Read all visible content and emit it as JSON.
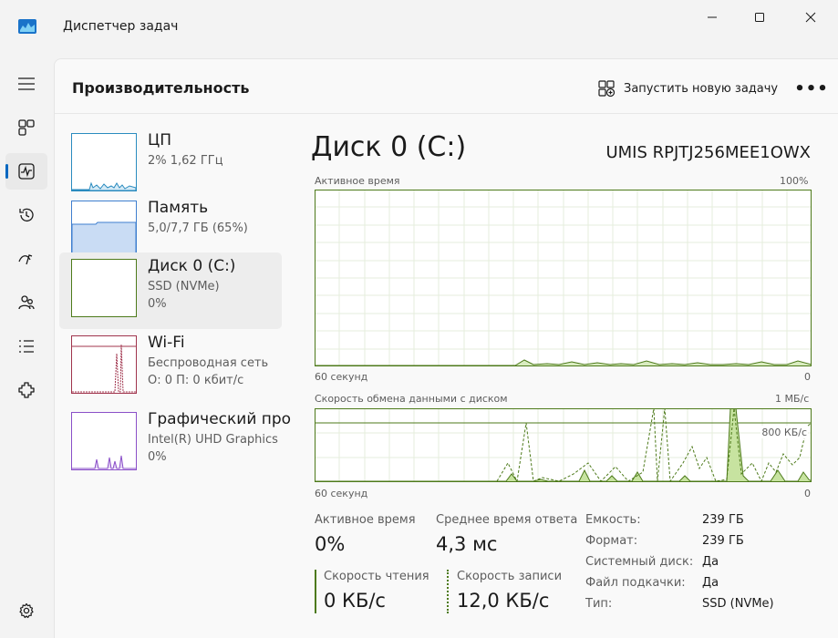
{
  "window": {
    "title": "Диспетчер задач"
  },
  "header": {
    "page_title": "Производительность",
    "run_task_label": "Запустить новую задачу",
    "more_label": "•••"
  },
  "resources": [
    {
      "name": "ЦП",
      "line1": "2%  1,62 ГГц",
      "line2": ""
    },
    {
      "name": "Память",
      "line1": "5,0/7,7 ГБ (65%)",
      "line2": ""
    },
    {
      "name": "Диск 0 (C:)",
      "line1": "SSD (NVMe)",
      "line2": "0%"
    },
    {
      "name": "Wi-Fi",
      "line1": "Беспроводная сеть",
      "line2": "О: 0  П: 0 кбит/с"
    },
    {
      "name": "Графический про",
      "line1": "Intel(R) UHD Graphics",
      "line2": "0%"
    }
  ],
  "detail": {
    "title": "Диск 0 (C:)",
    "model": "UMIS RPJTJ256MEE1OWX",
    "graph1": {
      "label": "Активное время",
      "max": "100%",
      "time_label": "60 секунд",
      "min": "0"
    },
    "graph2": {
      "label": "Скорость обмена данными с диском",
      "max": "1 МБ/с",
      "mid": "800 КБ/с",
      "time_label": "60 секунд",
      "min": "0"
    },
    "stats": {
      "active_time_label": "Активное время",
      "active_time_value": "0%",
      "response_label": "Среднее время ответа",
      "response_value": "4,3 мс",
      "read_label": "Скорость чтения",
      "read_value": "0 КБ/с",
      "write_label": "Скорость записи",
      "write_value": "12,0 КБ/с"
    },
    "properties": [
      {
        "key": "Емкость:",
        "value": "239 ГБ"
      },
      {
        "key": "Формат:",
        "value": "239 ГБ"
      },
      {
        "key": "Системный диск:",
        "value": "Да"
      },
      {
        "key": "Файл подкачки:",
        "value": "Да"
      },
      {
        "key": "Тип:",
        "value": "SSD (NVMe)"
      }
    ]
  },
  "colors": {
    "disk_line": "#4d7a1a",
    "disk_fill": "#c7e3a0",
    "cpu_line": "#2a8bbf",
    "memory_fill": "#c9dcf4",
    "memory_line": "#3f7fcf",
    "wifi_line": "#a0344d",
    "gpu_line": "#8a4fc8",
    "accent": "#0067c0"
  },
  "icons": [
    "task-manager-icon",
    "hamburger-icon",
    "processes-icon",
    "performance-icon",
    "app-history-icon",
    "startup-apps-icon",
    "users-icon",
    "details-icon",
    "services-icon",
    "settings-icon",
    "run-task-icon"
  ]
}
